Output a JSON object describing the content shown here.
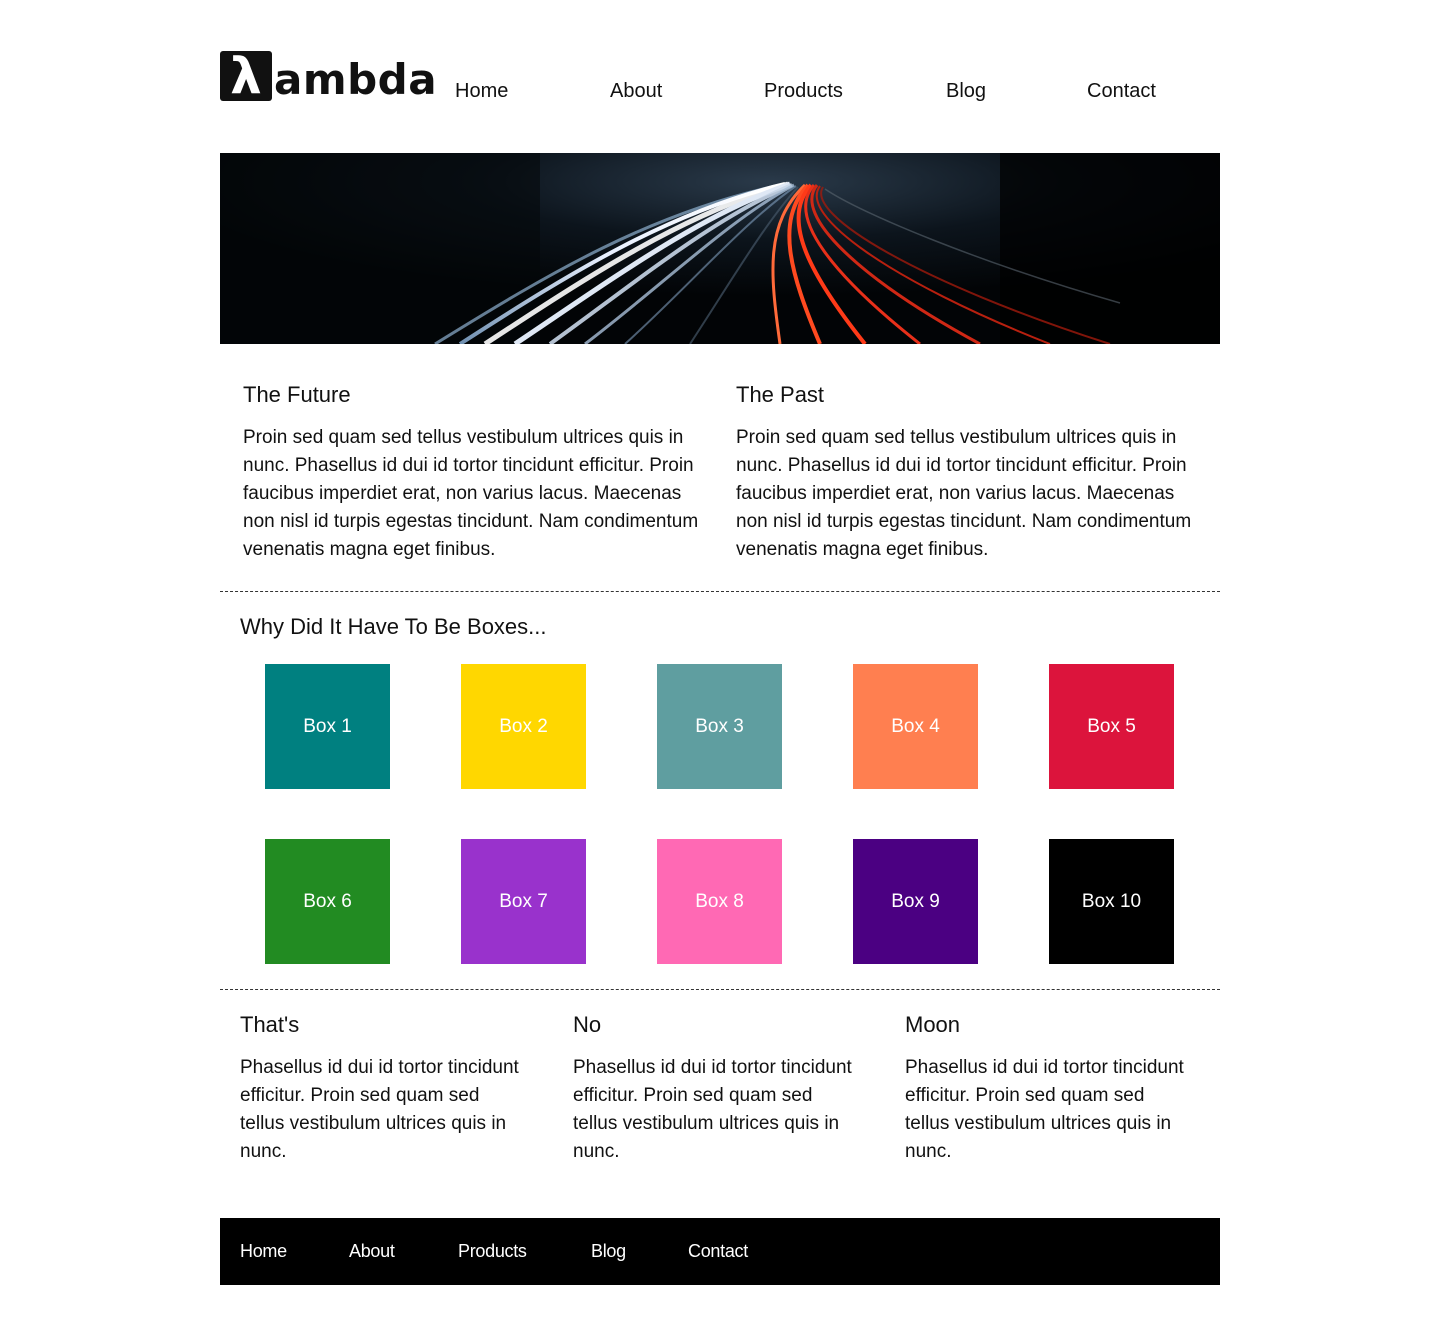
{
  "header": {
    "logo_symbol": "λ",
    "logo_text": "ambda",
    "nav": [
      "Home",
      "About",
      "Products",
      "Blog",
      "Contact"
    ]
  },
  "hero": {
    "image": "night highway light trails"
  },
  "columns": [
    {
      "title": "The Future",
      "text": "Proin sed quam sed tellus vestibulum ultrices quis in nunc. Phasellus id dui id tortor tincidunt efficitur. Proin faucibus imperdiet erat, non varius lacus. Maecenas non nisl id turpis egestas tincidunt. Nam condimentum venenatis magna eget finibus."
    },
    {
      "title": "The Past",
      "text": "Proin sed quam sed tellus vestibulum ultrices quis in nunc. Phasellus id dui id tortor tincidunt efficitur. Proin faucibus imperdiet erat, non varius lacus. Maecenas non nisl id turpis egestas tincidunt. Nam condimentum venenatis magna eget finibus."
    }
  ],
  "boxes_section": {
    "title": "Why Did It Have To Be Boxes...",
    "boxes": [
      {
        "label": "Box 1",
        "color": "#008080"
      },
      {
        "label": "Box 2",
        "color": "#FFD700"
      },
      {
        "label": "Box 3",
        "color": "#5F9EA0"
      },
      {
        "label": "Box 4",
        "color": "#FF7F50"
      },
      {
        "label": "Box 5",
        "color": "#DC143C"
      },
      {
        "label": "Box 6",
        "color": "#228B22"
      },
      {
        "label": "Box 7",
        "color": "#9932CC"
      },
      {
        "label": "Box 8",
        "color": "#FF69B4"
      },
      {
        "label": "Box 9",
        "color": "#4B0082"
      },
      {
        "label": "Box 10",
        "color": "#000000"
      }
    ]
  },
  "trio": [
    {
      "title": "That's",
      "text": "Phasellus id dui id tortor tincidunt efficitur. Proin sed quam sed tellus vestibulum ultrices quis in nunc."
    },
    {
      "title": "No",
      "text": "Phasellus id dui id tortor tincidunt efficitur. Proin sed quam sed tellus vestibulum ultrices quis in nunc."
    },
    {
      "title": "Moon",
      "text": "Phasellus id dui id tortor tincidunt efficitur. Proin sed quam sed tellus vestibulum ultrices quis in nunc."
    }
  ],
  "footer": {
    "nav": [
      "Home",
      "About",
      "Products",
      "Blog",
      "Contact"
    ]
  }
}
